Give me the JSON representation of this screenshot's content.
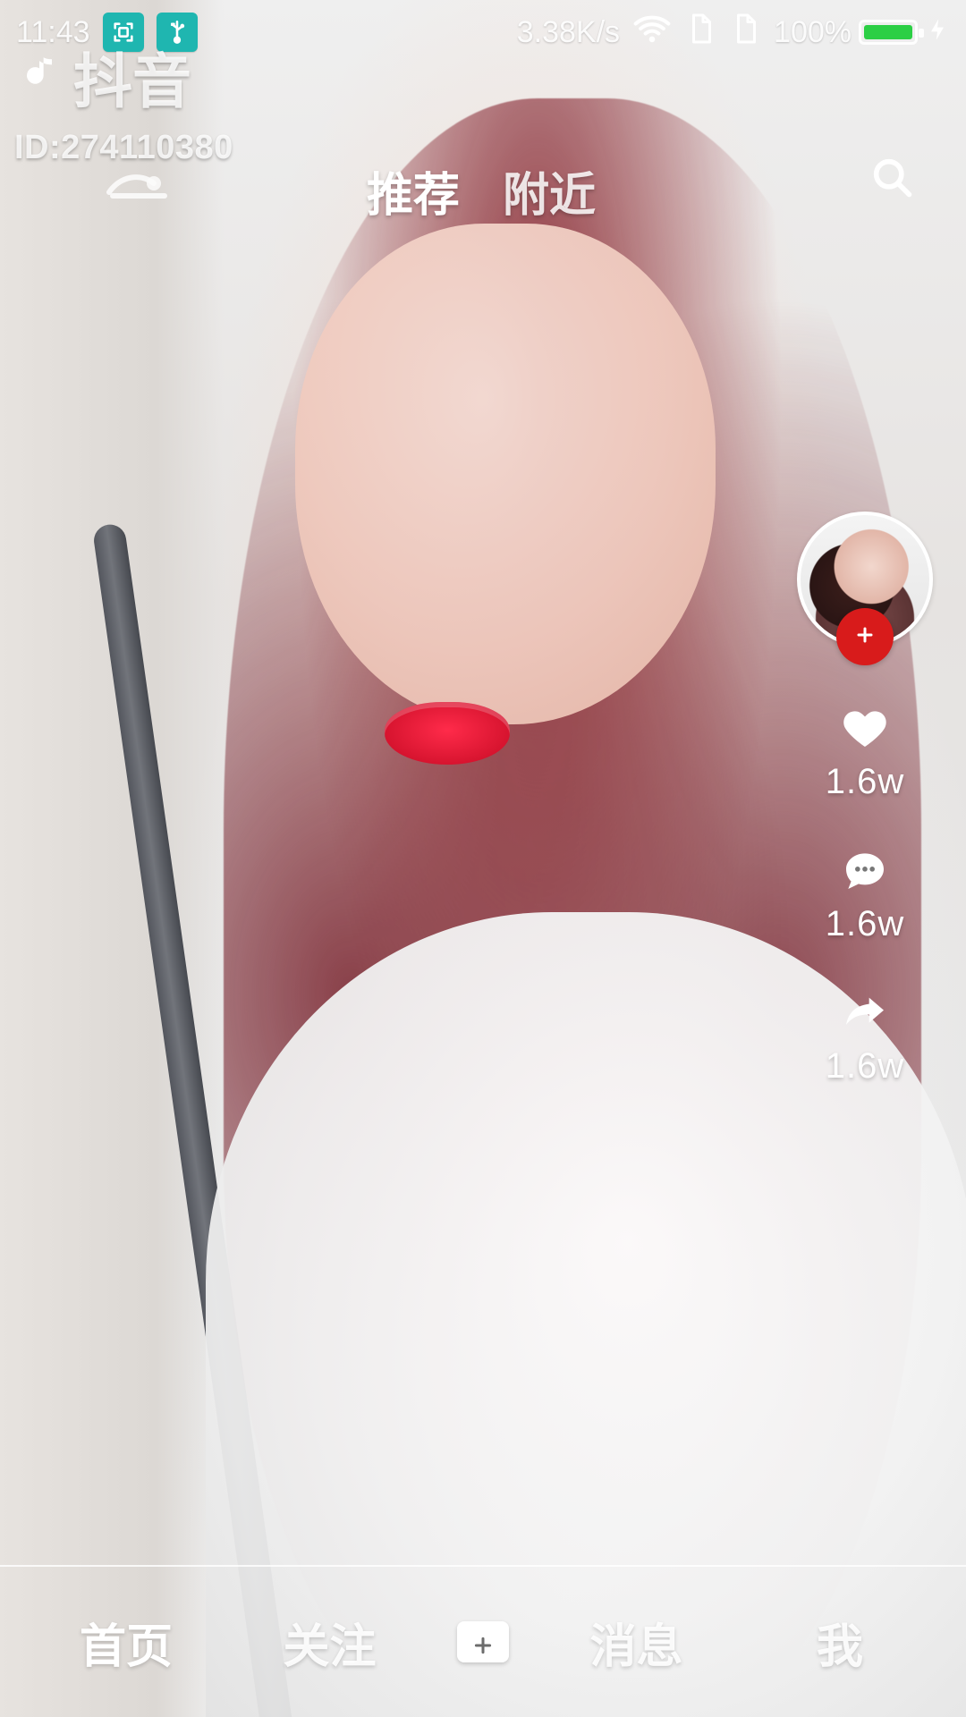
{
  "status_bar": {
    "time": "11:43",
    "network_speed": "3.38K/s",
    "battery_percent": "100%",
    "battery_level": 1.0,
    "icons": [
      "screenshot-icon",
      "usb-icon",
      "wifi-icon",
      "sim-icon",
      "sim-icon",
      "battery-icon",
      "charging-icon"
    ]
  },
  "watermark": {
    "app_name": "抖音",
    "id_text": "ID:274110380"
  },
  "top_tabs": [
    {
      "label": "推荐",
      "active": true
    },
    {
      "label": "附近",
      "active": false
    }
  ],
  "right_actions": {
    "likes": "1.6w",
    "comments": "1.6w",
    "shares": "1.6w"
  },
  "bottom_nav": [
    {
      "label": "首页",
      "active": true
    },
    {
      "label": "关注",
      "active": false
    },
    {
      "label": "",
      "active": false,
      "type": "add"
    },
    {
      "label": "消息",
      "active": false
    },
    {
      "label": "我",
      "active": false
    }
  ],
  "colors": {
    "accent_red": "#d81b1b",
    "status_teal": "#1fb6b0",
    "battery_green": "#2ccf45"
  }
}
